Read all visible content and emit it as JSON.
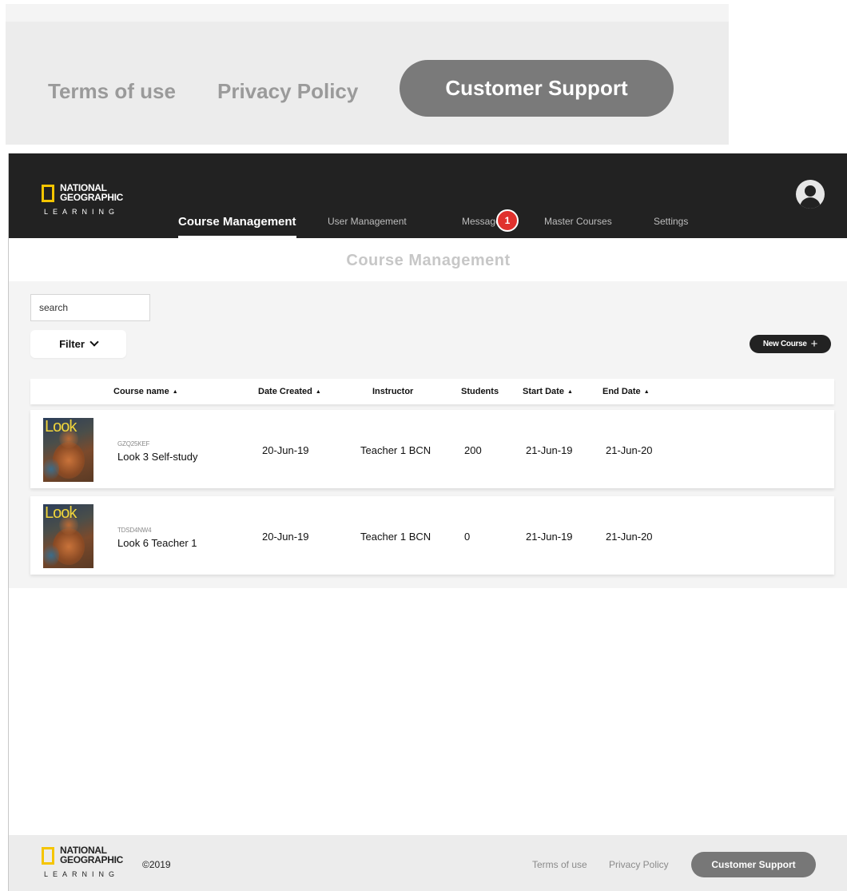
{
  "zoom": {
    "terms": "Terms of use",
    "privacy": "Privacy Policy",
    "support": "Customer Support"
  },
  "brand": {
    "line1": "NATIONAL",
    "line2": "GEOGRAPHIC",
    "line3": "LEARNING",
    "accent_color": "#f5c500"
  },
  "nav": {
    "items": [
      {
        "label": "Course Management",
        "active": true
      },
      {
        "label": "User Management",
        "active": false
      },
      {
        "label": "Messages",
        "active": false
      },
      {
        "label": "Master Courses",
        "active": false
      },
      {
        "label": "Settings",
        "active": false
      }
    ],
    "messages_badge": "1",
    "badge_color": "#e0312d"
  },
  "page": {
    "title": "Course Management"
  },
  "toolbar": {
    "search_placeholder": "search",
    "filter_label": "Filter",
    "new_course_label": "New Course",
    "new_course_icon": "+"
  },
  "table": {
    "sort_icon": "▲",
    "columns": [
      "Course name",
      "Date Created",
      "Instructor",
      "Students",
      "Start Date",
      "End Date"
    ],
    "rows": [
      {
        "cover_text": "Look",
        "code": "GZQ25KEF",
        "name": "Look 3 Self-study",
        "date_created": "20-Jun-19",
        "instructor": "Teacher 1 BCN",
        "students": "200",
        "start_date": "21-Jun-19",
        "end_date": "21-Jun-20"
      },
      {
        "cover_text": "Look",
        "code": "TDSD4NW4",
        "name": "Look 6 Teacher 1",
        "date_created": "20-Jun-19",
        "instructor": "Teacher 1 BCN",
        "students": "0",
        "start_date": "21-Jun-19",
        "end_date": "21-Jun-20"
      }
    ]
  },
  "footer": {
    "copyright": "©2019",
    "terms": "Terms of use",
    "privacy": "Privacy Policy",
    "support": "Customer Support"
  }
}
